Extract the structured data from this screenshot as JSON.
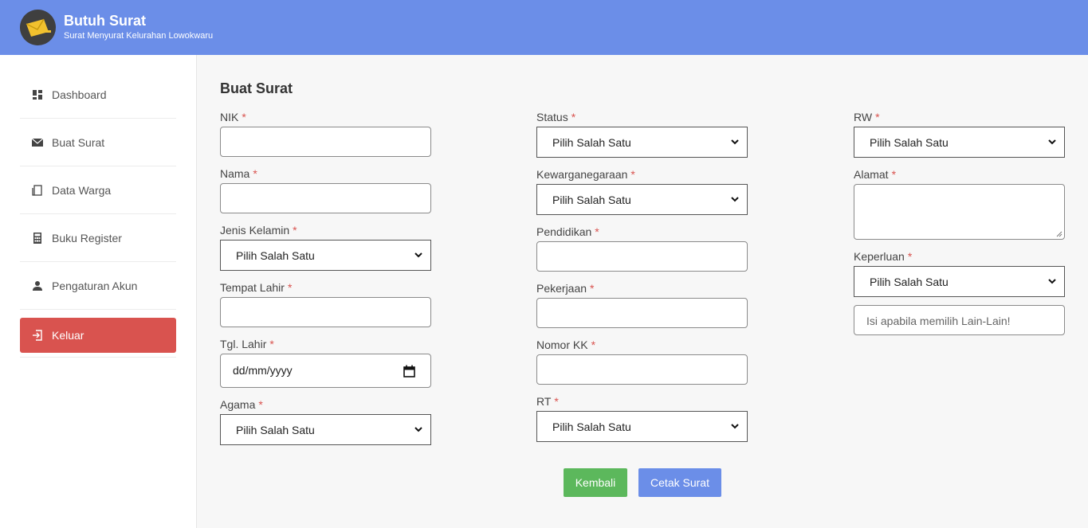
{
  "app": {
    "title": "Butuh Surat",
    "subtitle": "Surat Menyurat Kelurahan Lowokwaru"
  },
  "sidebar": {
    "items": [
      {
        "label": "Dashboard",
        "icon": "dashboard-icon"
      },
      {
        "label": "Buat Surat",
        "icon": "envelope-icon"
      },
      {
        "label": "Data Warga",
        "icon": "copy-icon"
      },
      {
        "label": "Buku Register",
        "icon": "calculator-icon"
      },
      {
        "label": "Pengaturan Akun",
        "icon": "user-icon"
      },
      {
        "label": "Keluar",
        "icon": "logout-icon"
      }
    ]
  },
  "form": {
    "title": "Buat Surat",
    "required_mark": "*",
    "select_default": "Pilih Salah Satu",
    "fields": {
      "nik": {
        "label": "NIK",
        "value": ""
      },
      "nama": {
        "label": "Nama",
        "value": ""
      },
      "jenis_kelamin": {
        "label": "Jenis Kelamin",
        "value": "Pilih Salah Satu"
      },
      "tempat_lahir": {
        "label": "Tempat Lahir",
        "value": ""
      },
      "tgl_lahir": {
        "label": "Tgl. Lahir",
        "value": "dd/mm/yyyy"
      },
      "agama": {
        "label": "Agama",
        "value": "Pilih Salah Satu"
      },
      "status": {
        "label": "Status",
        "value": "Pilih Salah Satu"
      },
      "kewarganegaraan": {
        "label": "Kewarganegaraan",
        "value": "Pilih Salah Satu"
      },
      "pendidikan": {
        "label": "Pendidikan",
        "value": ""
      },
      "pekerjaan": {
        "label": "Pekerjaan",
        "value": ""
      },
      "nomor_kk": {
        "label": "Nomor KK",
        "value": ""
      },
      "rt": {
        "label": "RT",
        "value": "Pilih Salah Satu"
      },
      "rw": {
        "label": "RW",
        "value": "Pilih Salah Satu"
      },
      "alamat": {
        "label": "Alamat",
        "value": ""
      },
      "keperluan": {
        "label": "Keperluan",
        "value": "Pilih Salah Satu"
      },
      "lain_lain": {
        "placeholder": "Isi apabila memilih Lain-Lain!"
      }
    },
    "buttons": {
      "back": "Kembali",
      "print": "Cetak Surat"
    }
  },
  "colors": {
    "header": "#6b8ee8",
    "logout": "#d9534f",
    "back_button": "#5cb85c",
    "print_button": "#6b8ee8",
    "required": "#d9534f"
  }
}
